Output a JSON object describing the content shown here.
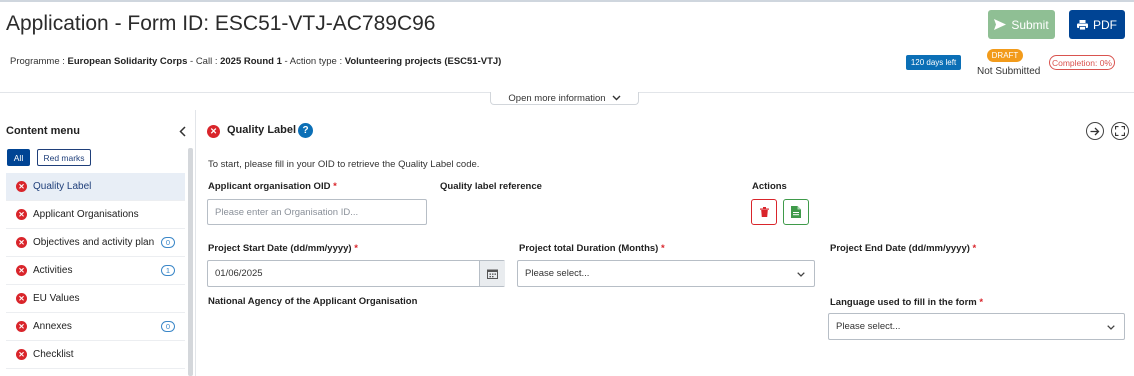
{
  "header": {
    "title": "Application - Form ID: ESC51-VTJ-AC789C96",
    "submit_label": "Submit",
    "pdf_label": "PDF",
    "meta": {
      "programme_label": "Programme : ",
      "programme_value": "European Solidarity Corps",
      "call_label": " - Call : ",
      "call_value": "2025 Round 1",
      "action_label": " - Action type : ",
      "action_value": "Volunteering projects (ESC51-VTJ)"
    },
    "days_left": "120 days left",
    "status_badge": "DRAFT",
    "status_text": "Not Submitted",
    "completion": "Completion: 0%",
    "open_more": "Open more information"
  },
  "sidebar": {
    "title": "Content menu",
    "filters": {
      "all": "All",
      "red_marks": "Red marks"
    },
    "items": [
      {
        "label": "Quality Label",
        "count": null
      },
      {
        "label": "Applicant Organisations",
        "count": null
      },
      {
        "label": "Objectives and activity plan",
        "count": "0"
      },
      {
        "label": "Activities",
        "count": "1"
      },
      {
        "label": "EU Values",
        "count": null
      },
      {
        "label": "Annexes",
        "count": "0"
      },
      {
        "label": "Checklist",
        "count": null
      }
    ]
  },
  "main": {
    "section_title": "Quality Label",
    "instructions": "To start, please fill in your OID to retrieve the Quality Label code.",
    "oid_label": "Applicant organisation OID",
    "oid_placeholder": "Please enter an Organisation ID...",
    "quality_ref_label": "Quality label reference",
    "actions_label": "Actions",
    "start_date_label": "Project Start Date (dd/mm/yyyy)",
    "start_date_value": "01/06/2025",
    "duration_label": "Project total Duration (Months)",
    "duration_value": "Please select...",
    "end_date_label": "Project End Date (dd/mm/yyyy)",
    "national_agency_label": "National Agency of the Applicant Organisation",
    "language_label": "Language used to fill in the form",
    "language_value": "Please select..."
  },
  "colors": {
    "primary": "#004494",
    "submit_disabled": "#8fbf94",
    "error": "#d9252b",
    "draft": "#f29b1b",
    "info": "#0b6fb6"
  },
  "icons": {
    "submit": "paper-plane-icon",
    "pdf": "printer-icon",
    "collapse": "chevron-left-icon",
    "error": "error-x-icon",
    "help": "question-icon",
    "next": "arrow-right-icon",
    "expand": "fullscreen-icon",
    "delete": "trash-icon",
    "document": "document-icon",
    "calendar": "calendar-icon",
    "dropdown": "chevron-down-icon"
  }
}
